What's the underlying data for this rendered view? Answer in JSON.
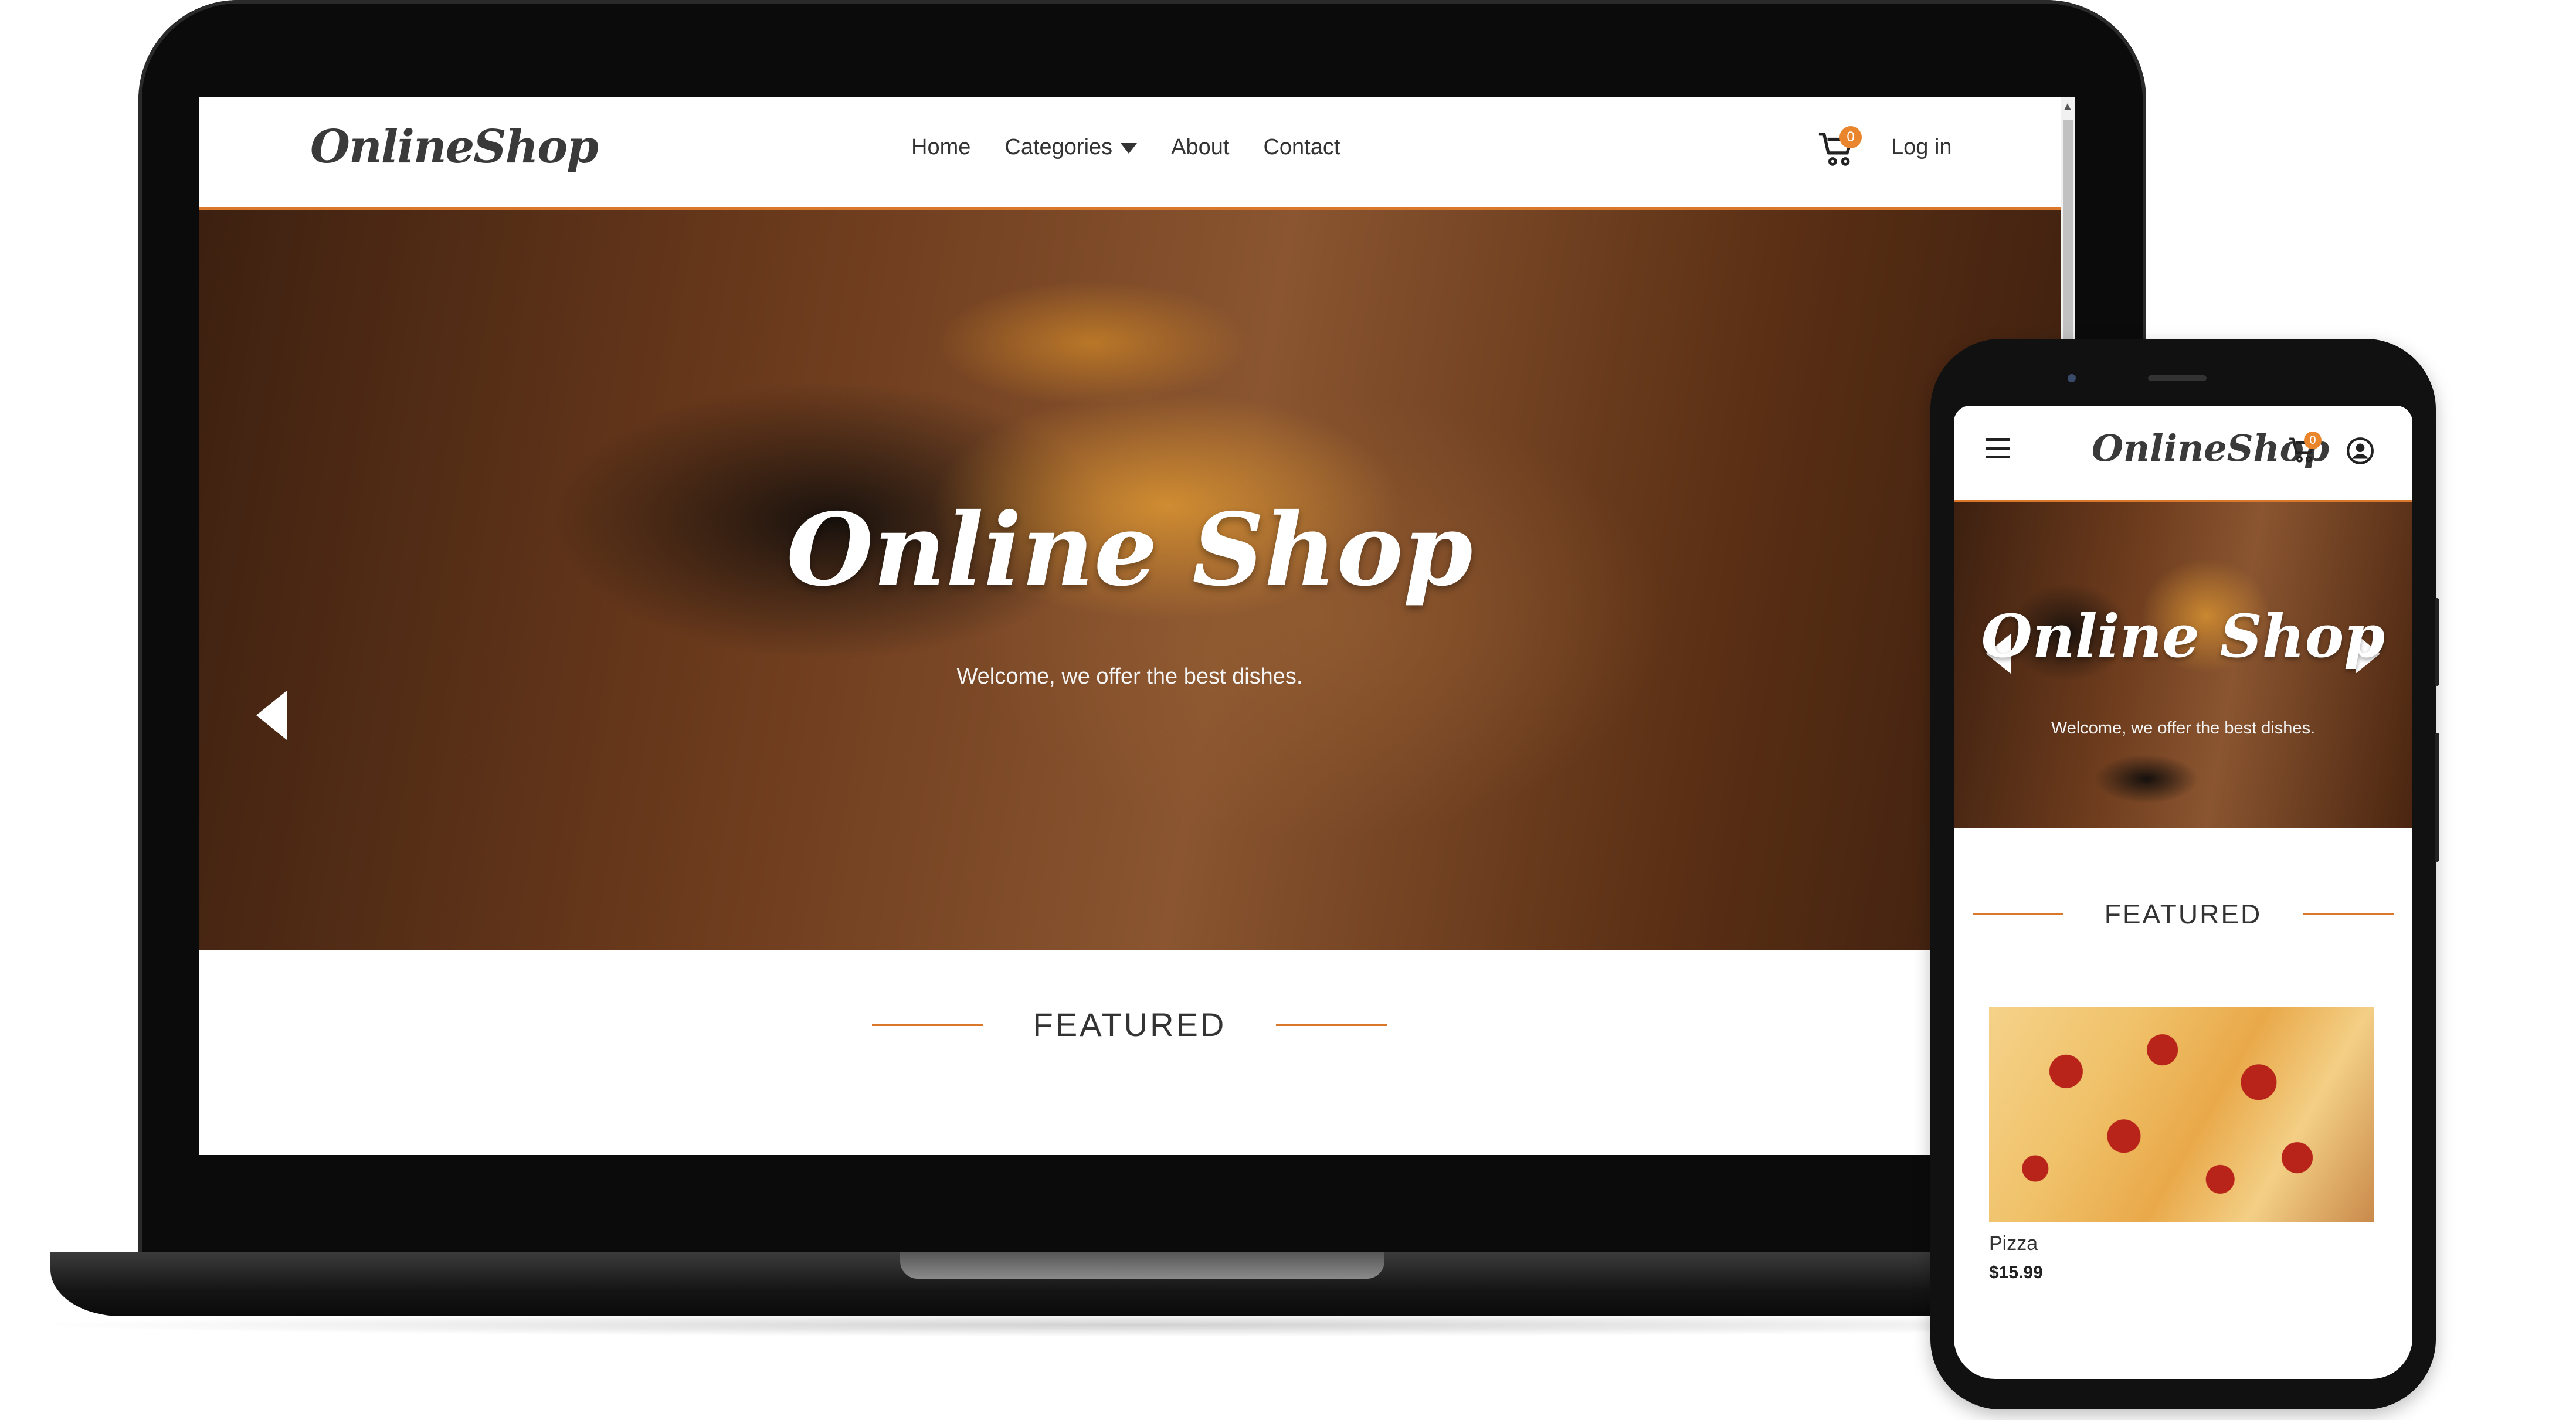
{
  "desktop": {
    "logo": "OnlineShop",
    "nav": {
      "home": "Home",
      "categories": "Categories",
      "about": "About",
      "contact": "Contact",
      "login": "Log in"
    },
    "cart_count": "0",
    "hero": {
      "title": "Online Shop",
      "subtitle": "Welcome, we offer the best dishes."
    },
    "featured_heading": "FEATURED"
  },
  "mobile": {
    "logo": "OnlineShop",
    "cart_count": "0",
    "hero": {
      "title": "Online Shop",
      "subtitle": "Welcome, we offer the best dishes."
    },
    "featured_heading": "FEATURED",
    "product": {
      "name": "Pizza",
      "price": "$15.99"
    }
  },
  "colors": {
    "accent": "#d9782a",
    "badge": "#e9852c",
    "text": "#333333"
  }
}
